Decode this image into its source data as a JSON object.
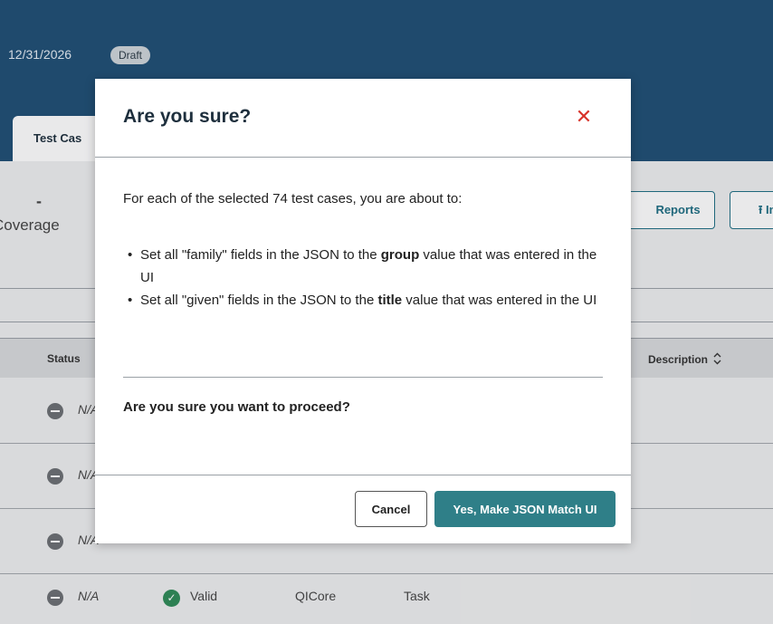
{
  "header": {
    "date": "12/31/2026",
    "status_badge": "Draft",
    "active_tab": "Test Cas"
  },
  "summary": {
    "coverage_value": "-",
    "coverage_label": "Coverage"
  },
  "toolbar": {
    "reports_label": "Reports",
    "import_label": "⭱ Im"
  },
  "table": {
    "headers": {
      "status": "Status",
      "description": "Description"
    },
    "sort_icon": "sort-icon",
    "rows": [
      {
        "status": "N/A"
      },
      {
        "status": "N/A"
      },
      {
        "status": "N/A"
      },
      {
        "status": "N/A",
        "validity": "Valid",
        "model": "QICore",
        "group": "Task"
      }
    ]
  },
  "modal": {
    "title": "Are you sure?",
    "close_icon": "close-icon",
    "intro_prefix": "For each of the selected ",
    "count": "74",
    "intro_suffix": " test cases, you are about to:",
    "bullets": [
      {
        "before": "Set all \"family\" fields in the JSON to the ",
        "bold": "group",
        "after": " value that was entered in the UI"
      },
      {
        "before": "Set all \"given\" fields in the JSON to the ",
        "bold": "title",
        "after": " value that was entered in the UI"
      }
    ],
    "question": "Are you sure you want to proceed?",
    "cancel_label": "Cancel",
    "confirm_label": "Yes, Make JSON Match UI"
  },
  "colors": {
    "header_bg": "#1f4e74",
    "accent": "#2f7f88",
    "close": "#d8332a",
    "valid": "#2e8b57"
  }
}
